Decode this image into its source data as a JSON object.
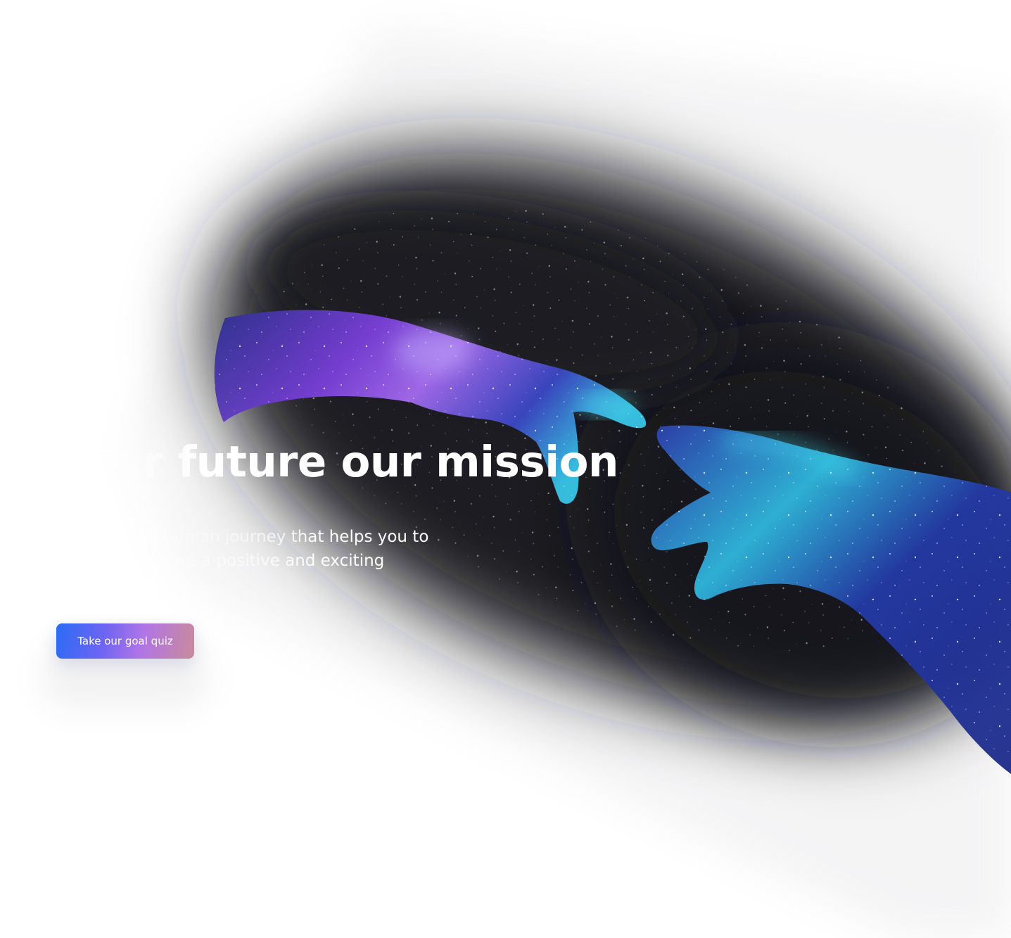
{
  "hero": {
    "title": "Your future our mission",
    "subtitle": "A digital and human journey that helps you to make your future a positive and exciting adventure",
    "cta_label": "Take our goal quiz"
  },
  "colors": {
    "background": "#ffffff",
    "space_dark": "#1c1b22",
    "text": "#ffffff",
    "cta_gradient_start": "#2a6cf6",
    "cta_gradient_mid": "#b175e6",
    "cta_gradient_end": "#c98a9a",
    "nebula_purple": "#8a4be8",
    "nebula_blue": "#2b3fb3",
    "nebula_cyan": "#37d6e8"
  },
  "icons": {
    "left_hand": "cosmic-hand-icon",
    "right_hand": "cosmic-hand-icon"
  }
}
